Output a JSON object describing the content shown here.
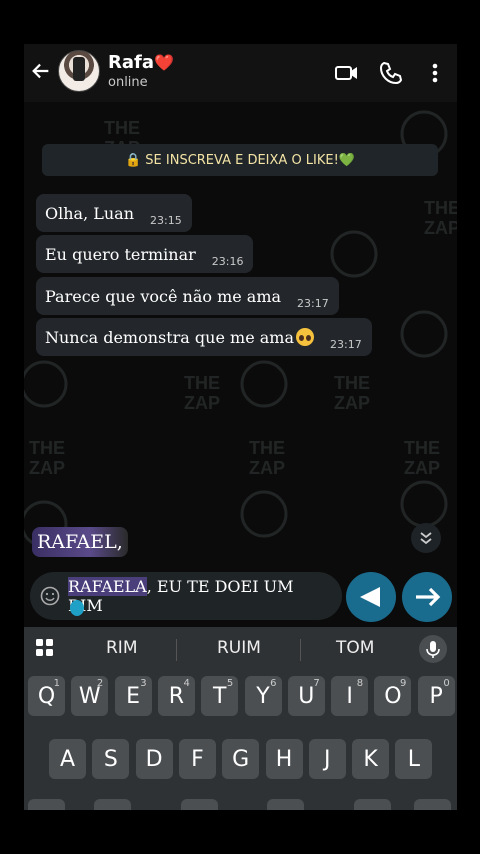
{
  "header": {
    "name": "Rafa",
    "heart": "❤️",
    "status": "online"
  },
  "banner": {
    "text": "🔒 SE INSCREVA E DEIXA O LIKE!💚"
  },
  "messages": [
    {
      "text": "Olha, Luan",
      "time": "23:15"
    },
    {
      "text": "Eu quero terminar",
      "time": "23:16"
    },
    {
      "text": "Parece que você não me ama",
      "time": "23:17"
    },
    {
      "text": "Nunca demonstra que me ama",
      "emoji": "pleading-face",
      "time": "23:17"
    }
  ],
  "overlay_word": "RAFAEL,",
  "input": {
    "selected": "RAFAELA",
    "rest_line1": ", EU TE DOEI UM",
    "line2": "RIM"
  },
  "keyboard": {
    "suggestions": [
      "RIM",
      "RUIM",
      "TOM"
    ],
    "row1": [
      {
        "k": "Q",
        "n": "1"
      },
      {
        "k": "W",
        "n": "2"
      },
      {
        "k": "E",
        "n": "3"
      },
      {
        "k": "R",
        "n": "4"
      },
      {
        "k": "T",
        "n": "5"
      },
      {
        "k": "Y",
        "n": "6"
      },
      {
        "k": "U",
        "n": "7"
      },
      {
        "k": "I",
        "n": "8"
      },
      {
        "k": "O",
        "n": "9"
      },
      {
        "k": "P",
        "n": "0"
      }
    ],
    "row2": [
      "A",
      "S",
      "D",
      "F",
      "G",
      "H",
      "J",
      "K",
      "L"
    ]
  },
  "colors": {
    "accent": "#1a6c8f",
    "bubble": "#23272b",
    "banner_text": "#f3e3a5"
  }
}
